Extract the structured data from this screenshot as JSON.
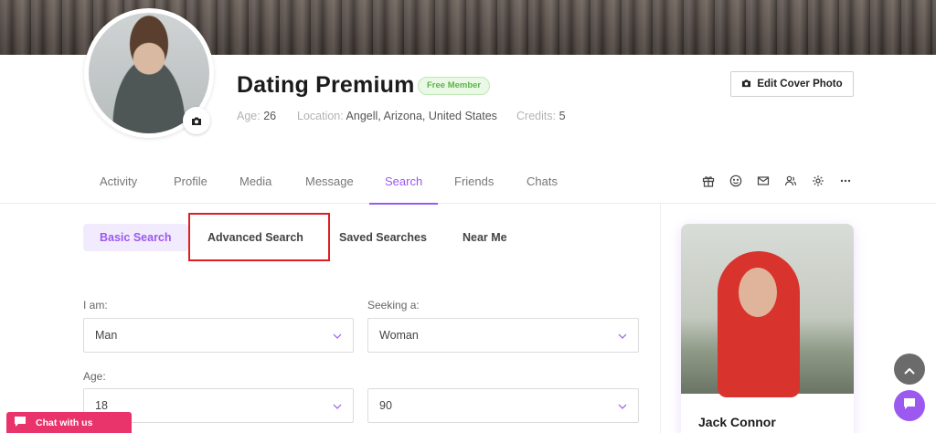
{
  "profile": {
    "name": "Dating Premium",
    "badge": "Free Member",
    "age_label": "Age:",
    "age_value": "26",
    "location_label": "Location:",
    "location_value": "Angell, Arizona, United States",
    "credits_label": "Credits:",
    "credits_value": "5",
    "edit_cover_label": "Edit Cover Photo"
  },
  "nav": {
    "tabs": [
      {
        "label": "Activity"
      },
      {
        "label": "Profile"
      },
      {
        "label": "Media"
      },
      {
        "label": "Message"
      },
      {
        "label": "Search",
        "active": true
      },
      {
        "label": "Friends"
      },
      {
        "label": "Chats"
      }
    ],
    "icons": [
      "gift-icon",
      "smile-icon",
      "mail-icon",
      "users-icon",
      "gear-icon",
      "more-icon"
    ]
  },
  "search": {
    "tabs": [
      {
        "label": "Basic Search",
        "active": true
      },
      {
        "label": "Advanced Search"
      },
      {
        "label": "Saved Searches"
      },
      {
        "label": "Near Me"
      }
    ],
    "i_am_label": "I am:",
    "i_am_value": "Man",
    "seeking_label": "Seeking a:",
    "seeking_value": "Woman",
    "age_label": "Age:",
    "age_from": "18",
    "age_to": "90"
  },
  "featured": {
    "name": "Jack Connor"
  },
  "chat": {
    "label": "Chat with us"
  },
  "colors": {
    "accent": "#9b59f0",
    "badge_green": "#5cb544",
    "chat_bar": "#e8336b",
    "highlight": "#e01e22"
  }
}
